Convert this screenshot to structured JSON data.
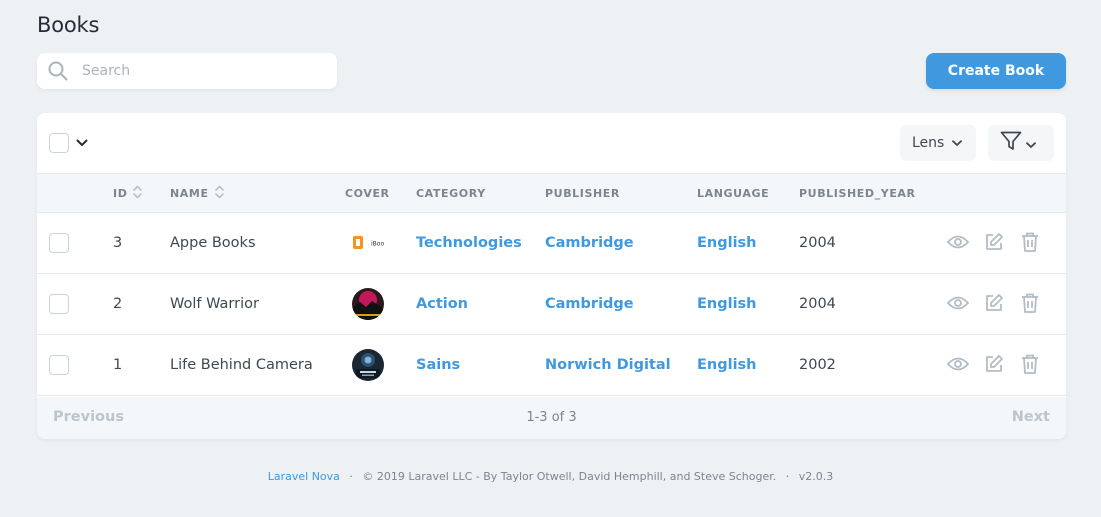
{
  "page": {
    "title": "Books"
  },
  "search": {
    "placeholder": "Search",
    "value": ""
  },
  "create_button": {
    "label": "Create Book"
  },
  "toolbar": {
    "lens_label": "Lens"
  },
  "columns": {
    "id": "ID",
    "name": "NAME",
    "cover": "COVER",
    "category": "CATEGORY",
    "publisher": "PUBLISHER",
    "language": "LANGUAGE",
    "published_year": "PUBLISHED_YEAR"
  },
  "rows": [
    {
      "id": "3",
      "name": "Appe Books",
      "category": "Technologies",
      "publisher": "Cambridge",
      "language": "English",
      "published_year": "2004",
      "cover_icon": "ibook-logo-icon"
    },
    {
      "id": "2",
      "name": "Wolf Warrior",
      "category": "Action",
      "publisher": "Cambridge",
      "language": "English",
      "published_year": "2004",
      "cover_icon": "movie-poster-icon"
    },
    {
      "id": "1",
      "name": "Life Behind Camera",
      "category": "Sains",
      "publisher": "Norwich Digital",
      "language": "English",
      "published_year": "2002",
      "cover_icon": "camera-cover-icon"
    }
  ],
  "pagination": {
    "previous": "Previous",
    "count": "1-3 of 3",
    "next": "Next"
  },
  "footer": {
    "link": "Laravel Nova",
    "copyright": "© 2019 Laravel LLC - By Taylor Otwell, David Hemphill, and Steve Schoger.",
    "version": "v2.0.3"
  },
  "colors": {
    "accent": "#4099de",
    "background": "#eef1f4",
    "muted": "#7c858e"
  }
}
